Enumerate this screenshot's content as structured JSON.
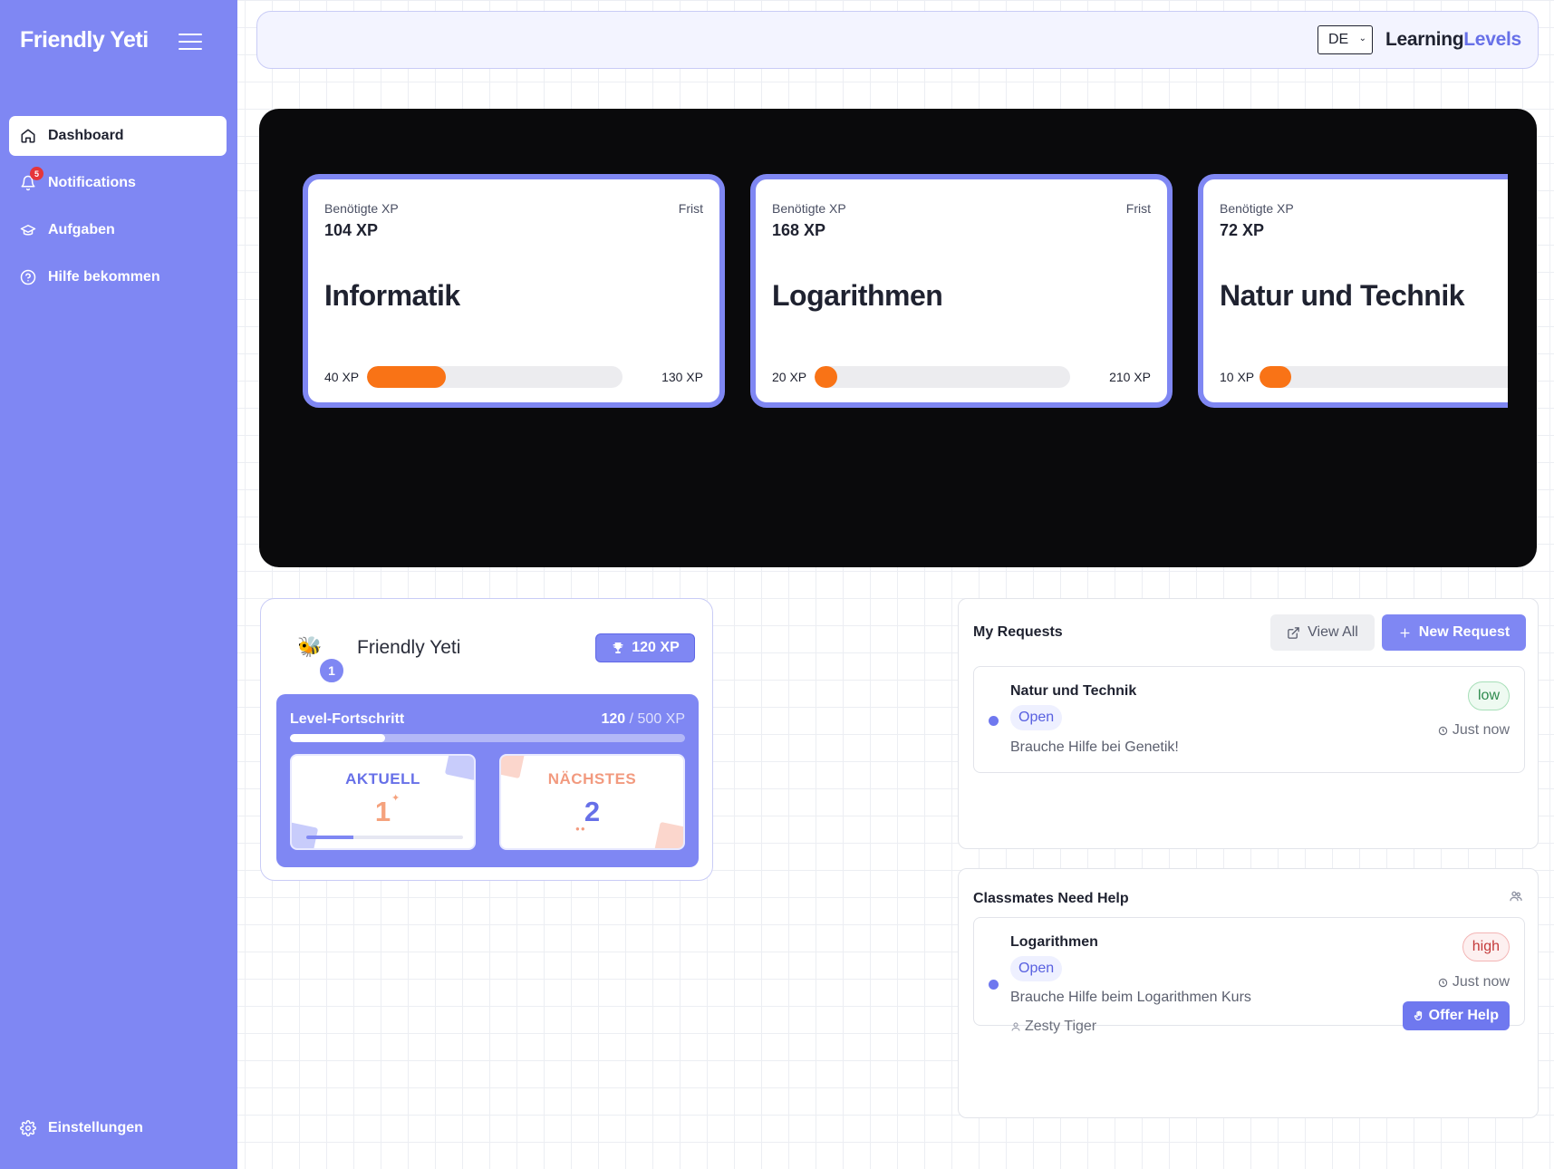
{
  "sidebar": {
    "brand": "Friendly Yeti",
    "items": [
      {
        "label": "Dashboard",
        "icon": "home-icon",
        "active": true
      },
      {
        "label": "Notifications",
        "icon": "bell-icon",
        "badge": "5"
      },
      {
        "label": "Aufgaben",
        "icon": "graduation-cap-icon"
      },
      {
        "label": "Hilfe bekommen",
        "icon": "help-circle-icon"
      }
    ],
    "settings_label": "Einstellungen"
  },
  "topbar": {
    "language": "DE",
    "logo_part1": "Learning",
    "logo_part2": "Levels"
  },
  "courses": [
    {
      "req_label": "Benötigte XP",
      "req_xp": "104 XP",
      "deadline_label": "Frist",
      "title": "Informatik",
      "min": "40 XP",
      "max": "130 XP",
      "progress": 0.31
    },
    {
      "req_label": "Benötigte XP",
      "req_xp": "168 XP",
      "deadline_label": "Frist",
      "title": "Logarithmen",
      "min": "20 XP",
      "max": "210 XP",
      "progress": 0.09
    },
    {
      "req_label": "Benötigte XP",
      "req_xp": "72 XP",
      "deadline_label": "",
      "title": "Natur und Technik",
      "min": "10 XP",
      "max": "",
      "progress": 0.12
    }
  ],
  "profile": {
    "emoji": "🐝",
    "level": "1",
    "name": "Friendly Yeti",
    "xp_badge": "120 XP",
    "level_progress_label": "Level-Fortschritt",
    "current_xp": "120",
    "total_xp": "/ 500 XP",
    "progress": 0.24,
    "current_label": "AKTUELL",
    "current_level": "1",
    "next_label": "NÄCHSTES",
    "next_level": "2"
  },
  "my_requests": {
    "title": "My Requests",
    "view_all": "View All",
    "new_request": "New Request",
    "items": [
      {
        "title": "Natur und Technik",
        "status": "Open",
        "description": "Brauche Hilfe bei Genetik!",
        "priority": "low",
        "time": "Just now"
      }
    ]
  },
  "classmates": {
    "title": "Classmates Need Help",
    "items": [
      {
        "title": "Logarithmen",
        "status": "Open",
        "description": "Brauche Hilfe beim Logarithmen Kurs",
        "author": "Zesty Tiger",
        "priority": "high",
        "time": "Just now",
        "action": "Offer Help"
      }
    ]
  },
  "colors": {
    "accent": "#7f87f3",
    "progress": "#f97316",
    "hero_bg": "#0a0a0c"
  }
}
